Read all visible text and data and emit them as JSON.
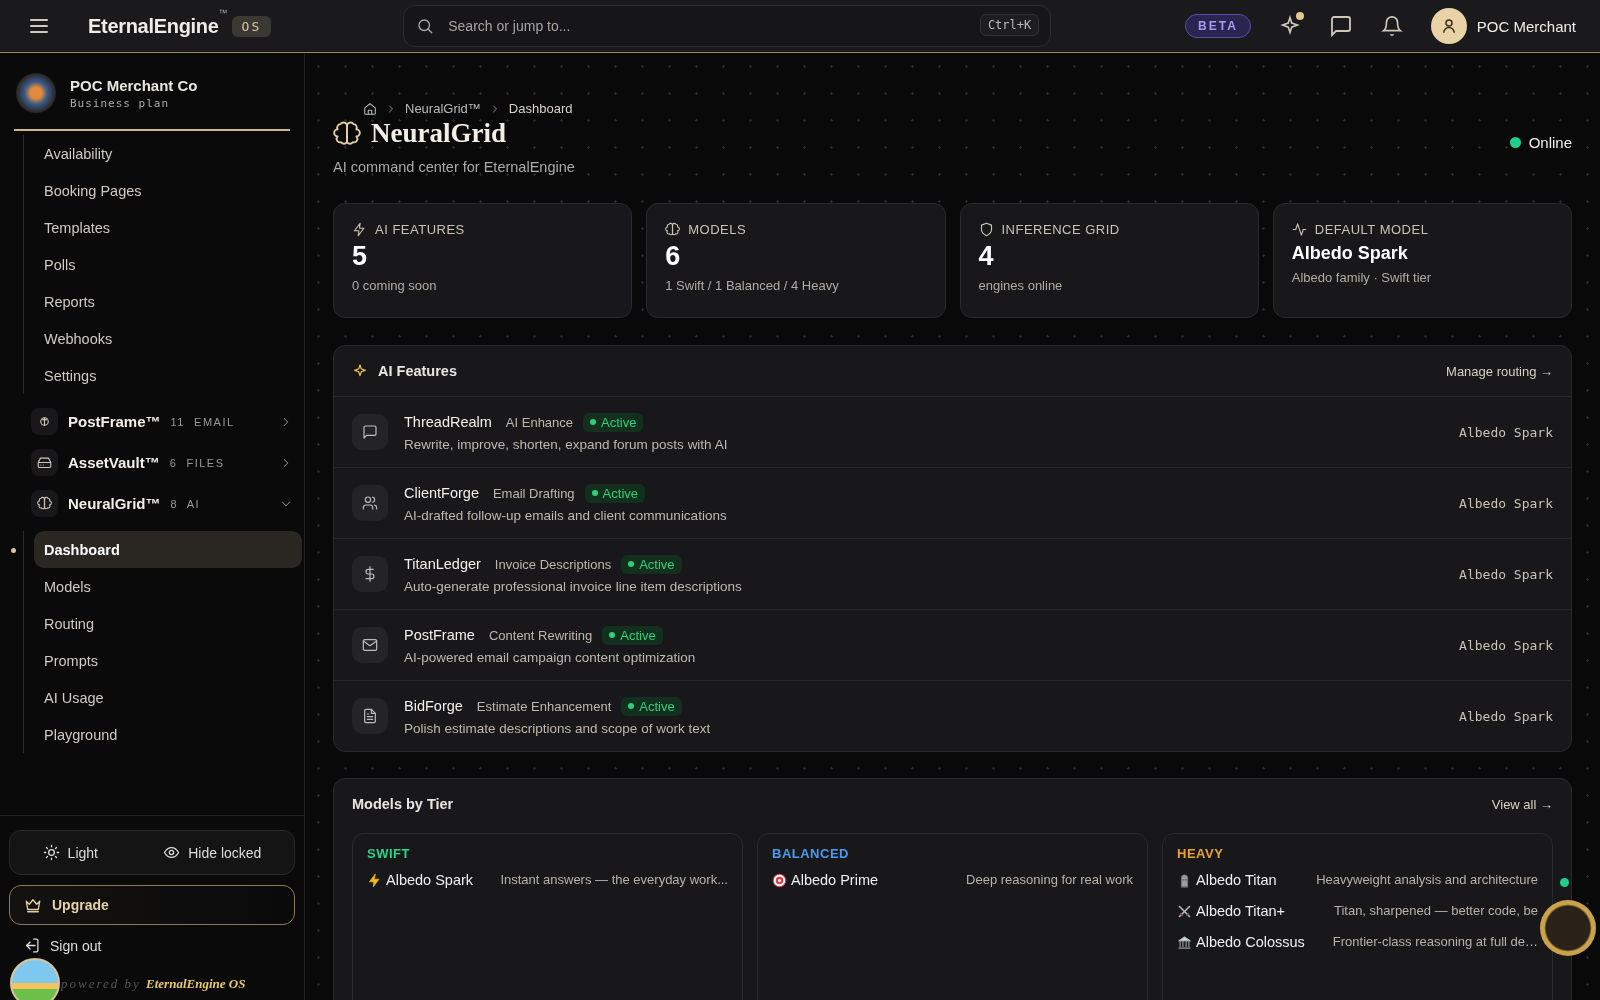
{
  "header": {
    "brand": "EternalEngine",
    "trademark": "™",
    "badge": "OS",
    "search": {
      "placeholder": "Search or jump to...",
      "shortcut": "Ctrl+K"
    },
    "beta": "BETA",
    "user": "POC Merchant"
  },
  "sidebar": {
    "org": {
      "name": "POC Merchant Co",
      "plan": "Business plan"
    },
    "items": [
      {
        "label": "Availability"
      },
      {
        "label": "Booking Pages"
      },
      {
        "label": "Templates"
      },
      {
        "label": "Polls"
      },
      {
        "label": "Reports"
      },
      {
        "label": "Webhooks"
      },
      {
        "label": "Settings"
      }
    ],
    "products": [
      {
        "name": "PostFrame™",
        "count": "11",
        "unit": "EMAIL",
        "expanded": false
      },
      {
        "name": "AssetVault™",
        "count": "6",
        "unit": "FILES",
        "expanded": false
      },
      {
        "name": "NeuralGrid™",
        "count": "8",
        "unit": "AI",
        "expanded": true,
        "children": [
          {
            "label": "Dashboard",
            "selected": true
          },
          {
            "label": "Models",
            "selected": false
          },
          {
            "label": "Routing",
            "selected": false
          },
          {
            "label": "Prompts",
            "selected": false
          },
          {
            "label": "AI Usage",
            "selected": false
          },
          {
            "label": "Playground",
            "selected": false
          }
        ]
      }
    ],
    "toggles": [
      "Light",
      "Hide locked"
    ],
    "upgrade": "Upgrade",
    "sign_out": "Sign out",
    "powered_by": {
      "prefix": "powered by",
      "brand": "EternalEngine OS"
    }
  },
  "page": {
    "breadcrumb": [
      "NeuralGrid™",
      "Dashboard"
    ],
    "title": "NeuralGrid",
    "subtitle": "AI command center for EternalEngine",
    "status": {
      "label": "Online",
      "color": "#1fcf8a"
    }
  },
  "stats": [
    {
      "label": "AI FEATURES",
      "value": "5",
      "kind": "number",
      "note": "0 coming soon"
    },
    {
      "label": "MODELS",
      "value": "6",
      "kind": "number",
      "note": "1 Swift / 1 Balanced / 4 Heavy"
    },
    {
      "label": "INFERENCE GRID",
      "value": "4",
      "kind": "number",
      "note": "engines online"
    },
    {
      "label": "DEFAULT MODEL",
      "value": "Albedo Spark",
      "kind": "text",
      "note": "Albedo family · Swift tier"
    }
  ],
  "features": {
    "title": "AI Features",
    "link": "Manage routing →",
    "rows": [
      {
        "name": "ThreadRealm",
        "category": "AI Enhance",
        "status": "Active",
        "description": "Rewrite, improve, shorten, expand forum posts with AI",
        "model": "Albedo Spark"
      },
      {
        "name": "ClientForge",
        "category": "Email Drafting",
        "status": "Active",
        "description": "AI-drafted follow-up emails and client communications",
        "model": "Albedo Spark"
      },
      {
        "name": "TitanLedger",
        "category": "Invoice Descriptions",
        "status": "Active",
        "description": "Auto-generate professional invoice line item descriptions",
        "model": "Albedo Spark"
      },
      {
        "name": "PostFrame",
        "category": "Content Rewriting",
        "status": "Active",
        "description": "AI-powered email campaign content optimization",
        "model": "Albedo Spark"
      },
      {
        "name": "BidForge",
        "category": "Estimate Enhancement",
        "status": "Active",
        "description": "Polish estimate descriptions and scope of work text",
        "model": "Albedo Spark"
      }
    ]
  },
  "tiers": {
    "title": "Models by Tier",
    "link": "View all →",
    "items": [
      {
        "name": "SWIFT",
        "color": "#2bd48a",
        "models": [
          {
            "name": "Albedo Spark",
            "description": "Instant answers — the everyday work..."
          }
        ]
      },
      {
        "name": "BALANCED",
        "color": "#4a9bf0",
        "models": [
          {
            "name": "Albedo Prime",
            "description": "Deep reasoning for real work"
          }
        ]
      },
      {
        "name": "HEAVY",
        "color": "#e8a52a",
        "models": [
          {
            "name": "Albedo Titan",
            "description": "Heavyweight analysis and architecture"
          },
          {
            "name": "Albedo Titan+",
            "description": "Titan, sharpened — better code, be"
          },
          {
            "name": "Albedo Colossus",
            "description": "Frontier-class reasoning at full de…"
          }
        ]
      }
    ]
  }
}
